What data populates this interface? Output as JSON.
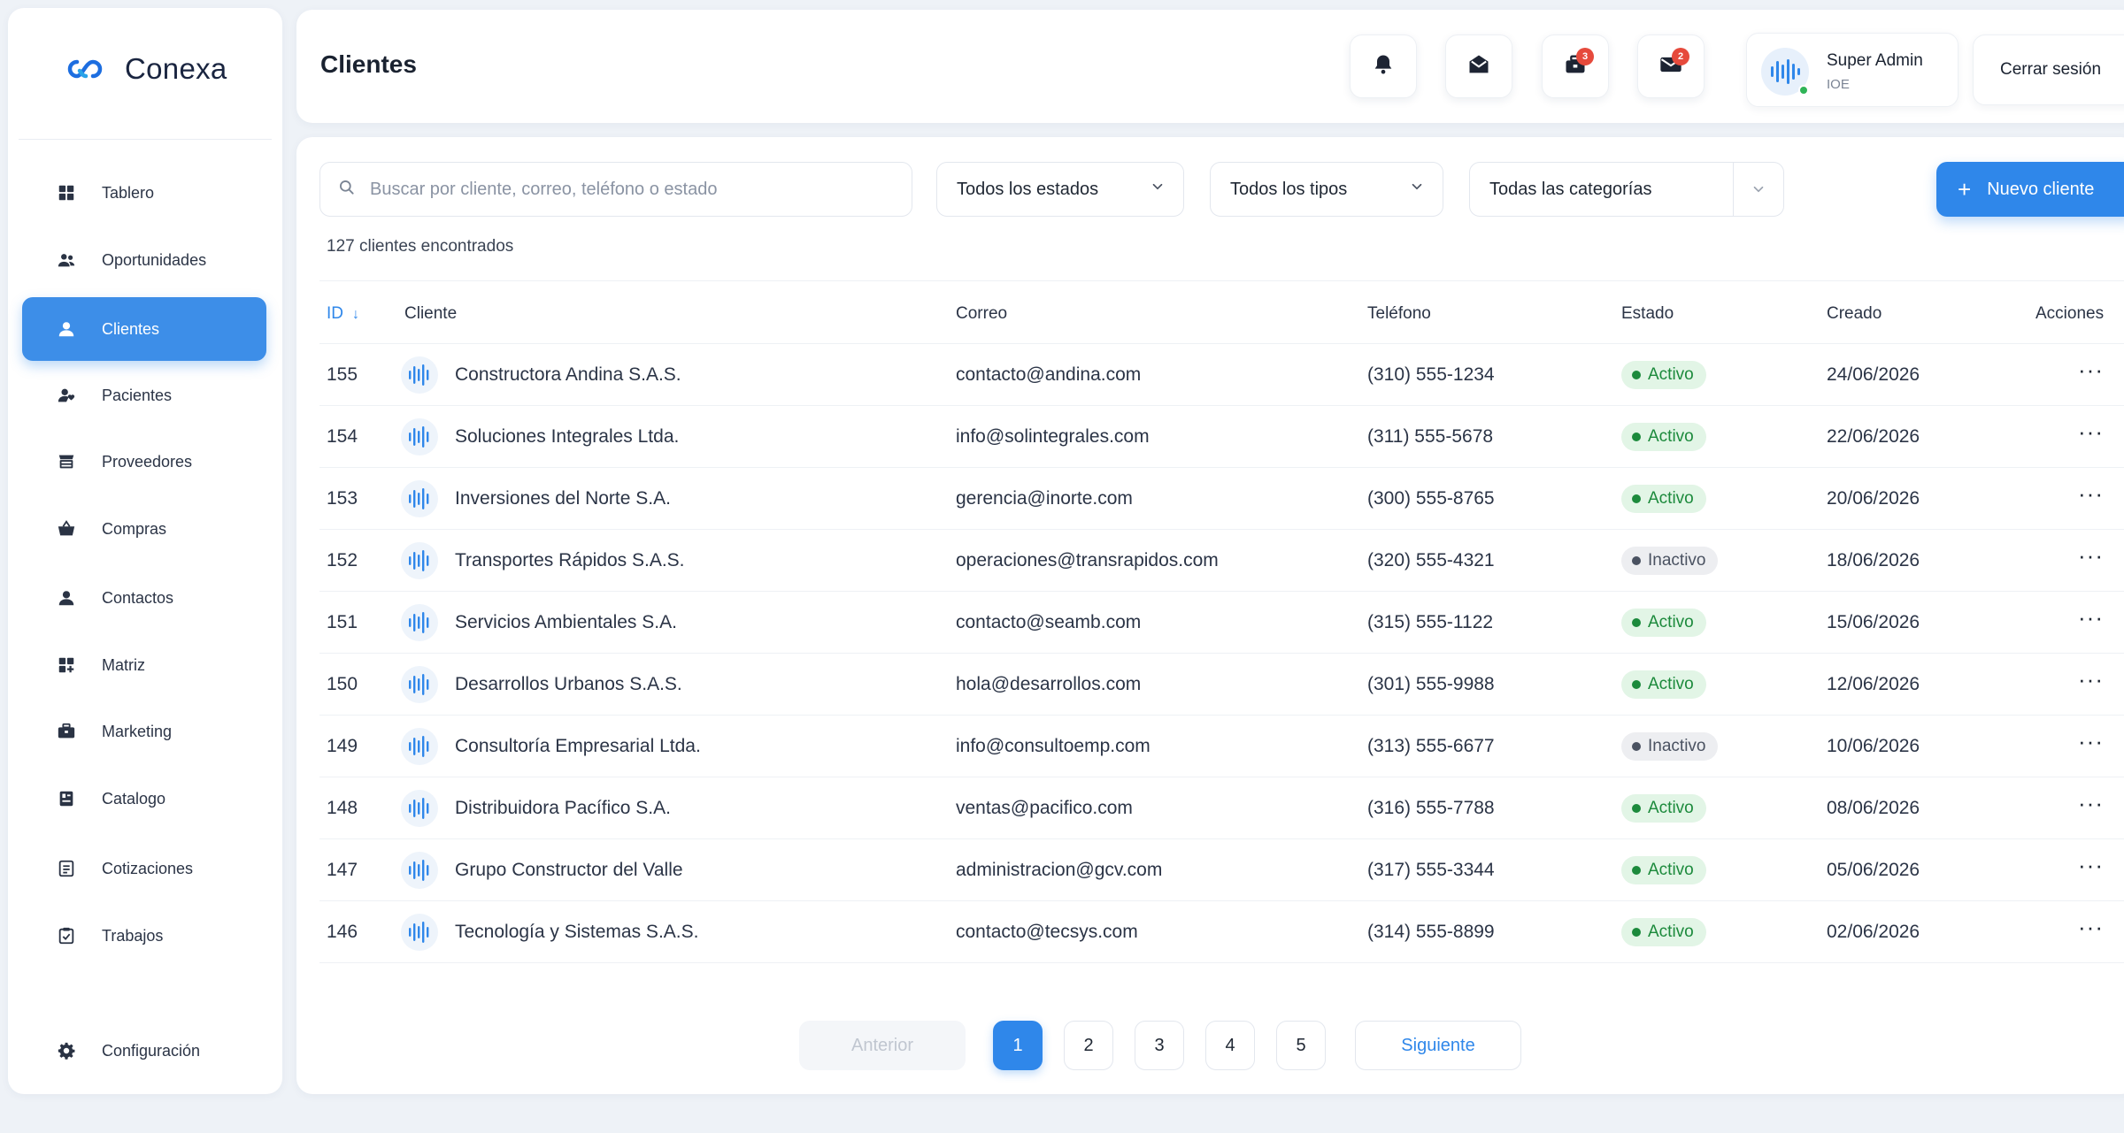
{
  "brand": {
    "name": "Conexa",
    "accent": "#1d6ee0"
  },
  "sidebar": {
    "items": [
      {
        "label": "Tablero",
        "icon": "grid-icon"
      },
      {
        "label": "Oportunidades",
        "icon": "users-icon"
      },
      {
        "label": "Clientes",
        "icon": "user-icon",
        "active": true
      },
      {
        "label": "Pacientes",
        "icon": "user-heart-icon"
      },
      {
        "label": "Proveedores",
        "icon": "store-icon"
      },
      {
        "label": "Compras",
        "icon": "basket-icon"
      },
      {
        "label": "Contactos",
        "icon": "user-icon"
      },
      {
        "label": "Matriz",
        "icon": "matrix-icon"
      },
      {
        "label": "Marketing",
        "icon": "briefcase-icon"
      },
      {
        "label": "Catalogo",
        "icon": "catalog-icon"
      },
      {
        "label": "Cotizaciones",
        "icon": "document-icon"
      },
      {
        "label": "Trabajos",
        "icon": "clipboard-icon"
      }
    ],
    "settings": {
      "label": "Configuración",
      "icon": "gear-icon"
    }
  },
  "header": {
    "title": "Clientes",
    "badges": {
      "tasks": "3",
      "mail": "2"
    },
    "user": {
      "name": "Super Admin",
      "role": "IOE"
    },
    "logout_label": "Cerrar sesión"
  },
  "filters": {
    "search_placeholder": "Buscar por cliente, correo, teléfono o estado",
    "estado": "Todos los estados",
    "tipo": "Todos los tipos",
    "categoria": "Todas las categorías",
    "new_button": "Nuevo cliente"
  },
  "count_text": "127 clientes encontrados",
  "table": {
    "columns": {
      "id": "ID",
      "cliente": "Cliente",
      "correo": "Correo",
      "telefono": "Teléfono",
      "estado": "Estado",
      "creado": "Creado",
      "acciones": "Acciones"
    },
    "rows": [
      {
        "id": "155",
        "name": "Constructora Andina S.A.S.",
        "email": "contacto@andina.com",
        "phone": "(310) 555-1234",
        "status": "Activo",
        "created": "24/06/2026"
      },
      {
        "id": "154",
        "name": "Soluciones Integrales Ltda.",
        "email": "info@solintegrales.com",
        "phone": "(311) 555-5678",
        "status": "Activo",
        "created": "22/06/2026"
      },
      {
        "id": "153",
        "name": "Inversiones del Norte S.A.",
        "email": "gerencia@inorte.com",
        "phone": "(300) 555-8765",
        "status": "Activo",
        "created": "20/06/2026"
      },
      {
        "id": "152",
        "name": "Transportes Rápidos S.A.S.",
        "email": "operaciones@transrapidos.com",
        "phone": "(320) 555-4321",
        "status": "Inactivo",
        "created": "18/06/2026"
      },
      {
        "id": "151",
        "name": "Servicios Ambientales S.A.",
        "email": "contacto@seamb.com",
        "phone": "(315) 555-1122",
        "status": "Activo",
        "created": "15/06/2026"
      },
      {
        "id": "150",
        "name": "Desarrollos Urbanos S.A.S.",
        "email": "hola@desarrollos.com",
        "phone": "(301) 555-9988",
        "status": "Activo",
        "created": "12/06/2026"
      },
      {
        "id": "149",
        "name": "Consultoría Empresarial Ltda.",
        "email": "info@consultoemp.com",
        "phone": "(313) 555-6677",
        "status": "Inactivo",
        "created": "10/06/2026"
      },
      {
        "id": "148",
        "name": "Distribuidora Pacífico S.A.",
        "email": "ventas@pacifico.com",
        "phone": "(316) 555-7788",
        "status": "Activo",
        "created": "08/06/2026"
      },
      {
        "id": "147",
        "name": "Grupo Constructor del Valle",
        "email": "administracion@gcv.com",
        "phone": "(317) 555-3344",
        "status": "Activo",
        "created": "05/06/2026"
      },
      {
        "id": "146",
        "name": "Tecnología y Sistemas S.A.S.",
        "email": "contacto@tecsys.com",
        "phone": "(314) 555-8899",
        "status": "Activo",
        "created": "02/06/2026"
      }
    ],
    "actions_glyph": "···"
  },
  "pagination": {
    "prev": "Anterior",
    "next": "Siguiente",
    "pages": [
      "1",
      "2",
      "3",
      "4",
      "5"
    ],
    "current": "1"
  }
}
